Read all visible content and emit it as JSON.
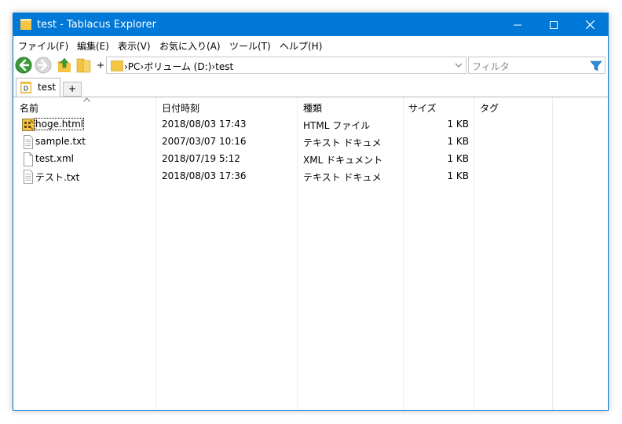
{
  "window": {
    "title": "test - Tablacus Explorer"
  },
  "menu": [
    "ファイル(F)",
    "編集(E)",
    "表示(V)",
    "お気に入り(A)",
    "ツール(T)",
    "ヘルプ(H)"
  ],
  "toolbar": {
    "plus": "+"
  },
  "address": {
    "crumbs": "›PC›ボリューム (D:)›test"
  },
  "filter": {
    "placeholder": "フィルタ"
  },
  "tabs": [
    {
      "label": "test",
      "icon_letter": "D"
    }
  ],
  "tab_add_label": "+",
  "columns": [
    "名前",
    "日付時刻",
    "種類",
    "サイズ",
    "タグ"
  ],
  "files": [
    {
      "name": "hoge.html",
      "date": "2018/08/03 17:43",
      "type": "HTML ファイル",
      "size": "1 KB",
      "icon": "html-file-icon"
    },
    {
      "name": "sample.txt",
      "date": "2007/03/07 10:16",
      "type": "テキスト ドキュメ",
      "size": "1 KB",
      "icon": "text-file-icon"
    },
    {
      "name": "test.xml",
      "date": "2018/07/19 5:12",
      "type": "XML ドキュメント",
      "size": "1 KB",
      "icon": "xml-file-icon"
    },
    {
      "name": "テスト.txt",
      "date": "2018/08/03 17:36",
      "type": "テキスト ドキュメ",
      "size": "1 KB",
      "icon": "text-file-icon"
    }
  ],
  "colors": {
    "title_bar": "#0078d7",
    "folder": "#f4c542",
    "back_arrow": "#3a9b3a"
  }
}
